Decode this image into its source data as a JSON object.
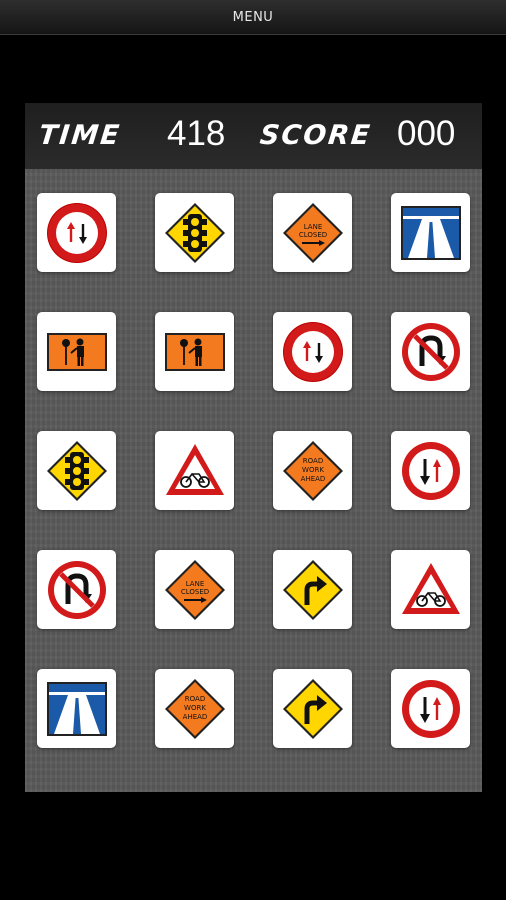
{
  "menu": {
    "label": "MENU"
  },
  "hud": {
    "time_label": "TIME",
    "time_value": "418",
    "score_label": "SCORE",
    "score_value": "000"
  },
  "colors": {
    "board": "#5b5b5b",
    "orange": "#f47a20",
    "yellow": "#ffd600",
    "red": "#d21a1a",
    "blue": "#1a5aa8"
  },
  "signs": {
    "lane_closed": [
      "LANE",
      "CLOSED"
    ],
    "road_work": [
      "ROAD",
      "WORK",
      "AHEAD"
    ]
  },
  "grid": [
    [
      "no-overtaking",
      "traffic-light",
      "lane-closed",
      "motorway"
    ],
    [
      "worker",
      "worker",
      "no-overtaking",
      "no-u-turn"
    ],
    [
      "traffic-light",
      "cyclists",
      "road-work",
      "priority-oncoming"
    ],
    [
      "no-u-turn",
      "lane-closed",
      "right-turn",
      "cyclists"
    ],
    [
      "motorway",
      "road-work",
      "right-turn",
      "priority-oncoming"
    ]
  ]
}
